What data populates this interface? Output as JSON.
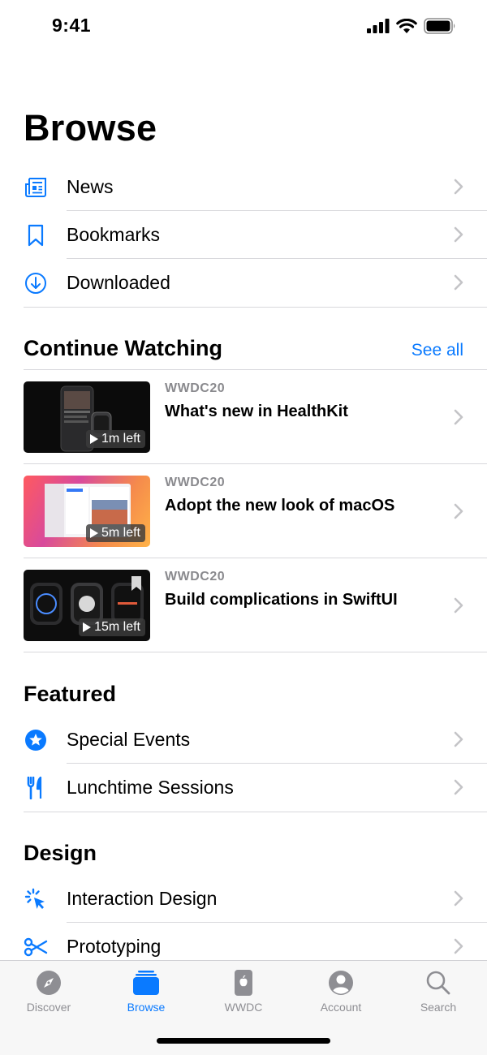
{
  "status_bar": {
    "time": "9:41"
  },
  "page": {
    "title": "Browse"
  },
  "top_list": [
    {
      "label": "News",
      "icon": "news-icon"
    },
    {
      "label": "Bookmarks",
      "icon": "bookmark-icon"
    },
    {
      "label": "Downloaded",
      "icon": "download-icon"
    }
  ],
  "continue_watching": {
    "title": "Continue Watching",
    "see_all": "See all",
    "items": [
      {
        "event": "WWDC20",
        "title": "What's new in HealthKit",
        "time_left": "1m left"
      },
      {
        "event": "WWDC20",
        "title": "Adopt the new look of macOS",
        "time_left": "5m left"
      },
      {
        "event": "WWDC20",
        "title": "Build complications in SwiftUI",
        "time_left": "15m left"
      }
    ]
  },
  "featured": {
    "title": "Featured",
    "items": [
      {
        "label": "Special Events",
        "icon": "star-icon"
      },
      {
        "label": "Lunchtime Sessions",
        "icon": "fork-knife-icon"
      }
    ]
  },
  "design": {
    "title": "Design",
    "items": [
      {
        "label": "Interaction Design",
        "icon": "tap-icon"
      },
      {
        "label": "Prototyping",
        "icon": "scissors-icon"
      }
    ]
  },
  "tabbar": {
    "tabs": [
      {
        "label": "Discover",
        "icon": "compass-icon"
      },
      {
        "label": "Browse",
        "icon": "stack-icon"
      },
      {
        "label": "WWDC",
        "icon": "phone-icon"
      },
      {
        "label": "Account",
        "icon": "person-icon"
      },
      {
        "label": "Search",
        "icon": "search-icon"
      }
    ],
    "active": "Browse"
  },
  "colors": {
    "accent": "#0a7aff",
    "inactive": "#8e8e93"
  }
}
